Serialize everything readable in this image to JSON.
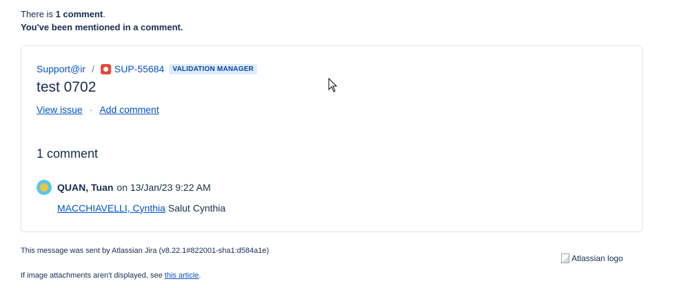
{
  "intro": {
    "line1_prefix": "There is ",
    "line1_bold": "1 comment",
    "line1_suffix": ".",
    "line2": "You've been mentioned in a comment."
  },
  "issue": {
    "project": "Support@ir",
    "separator": "/",
    "key": "SUP-55684",
    "status": "VALIDATION MANAGER",
    "title": "test 0702",
    "view_issue": "View issue",
    "action_separator": "·",
    "add_comment": "Add comment"
  },
  "comments": {
    "count_label": "1 comment",
    "items": [
      {
        "author": "QUAN, Tuan",
        "timestamp": "on 13/Jan/23 9:22 AM",
        "mention": "MACCHIAVELLI, Cynthia",
        "text": "Salut Cynthia"
      }
    ]
  },
  "footer": {
    "sent_by": "This message was sent by Atlassian Jira (v8.22.1#822001-sha1:d584a1e)",
    "attachments_prefix": "If image attachments aren't displayed, see ",
    "attachments_link": "this article",
    "attachments_suffix": ".",
    "logo_alt": "Atlassian logo"
  },
  "colors": {
    "link": "#0052cc",
    "text": "#172b4d",
    "issue_type_bug": "#e5493a",
    "status_bg": "#deebff",
    "status_text": "#0747a6",
    "card_border": "#dfe1e6"
  },
  "icons": {
    "issue_type": "bug-icon",
    "avatar": "user-avatar",
    "broken_image": "broken-image-icon",
    "cursor": "mouse-pointer"
  }
}
